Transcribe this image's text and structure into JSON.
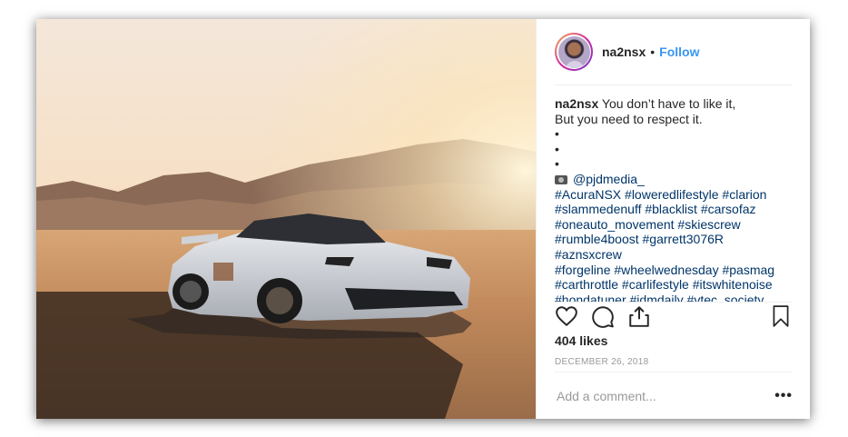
{
  "post": {
    "username": "na2nsx",
    "separator": "•",
    "follow_label": "Follow",
    "caption": {
      "username": "na2nsx",
      "lines": [
        "You don’t have to like it,",
        "But you need to respect it.",
        "•",
        "•",
        "•"
      ],
      "credit": "@pjdmedia_",
      "hashtags": [
        "#AcuraNSX #loweredlifestyle #clarion",
        "#slammedenuff #blacklist #carsofaz",
        "#oneauto_movement #skiescrew",
        "#rumble4boost #garrett3076R #aznsxcrew",
        "#forgeline #wheelwednesday #pasmag",
        "#carthrottle #carlifestyle #itswhitenoise",
        "#hondatuner #jdmdaily #vtec_society"
      ]
    },
    "likes": "404 likes",
    "date": "DECEMBER 26, 2018",
    "comment_placeholder": "Add a comment...",
    "more_label": "•••",
    "icons": [
      "heart-icon",
      "comment-icon",
      "share-icon",
      "bookmark-icon",
      "camera-icon"
    ]
  }
}
